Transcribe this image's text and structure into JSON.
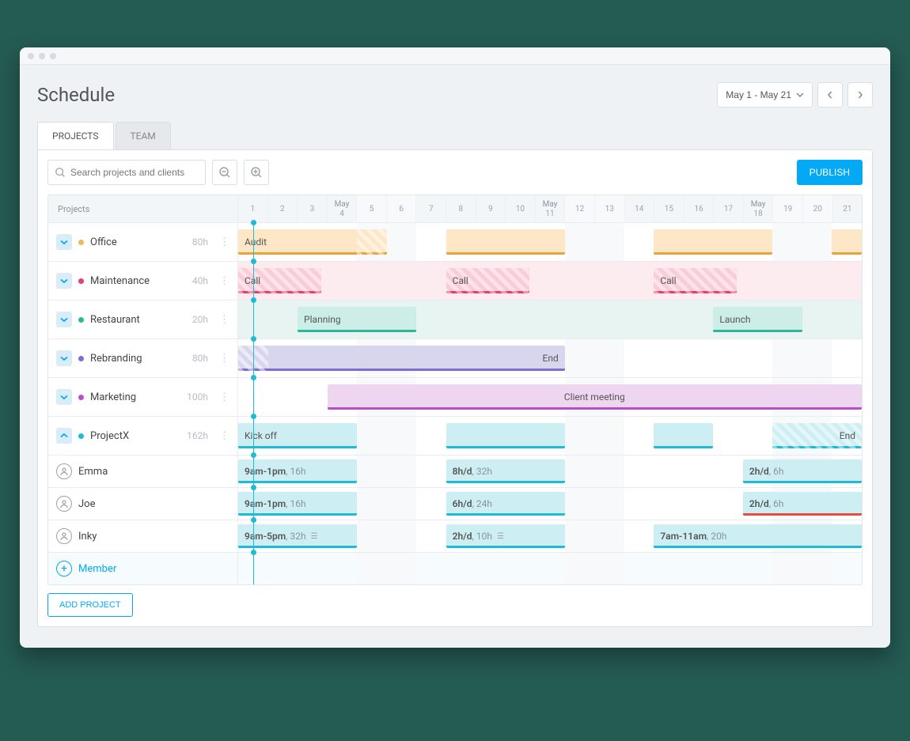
{
  "header": {
    "title": "Schedule",
    "date_range": "May 1 - May 21"
  },
  "tabs": {
    "projects": "PROJECTS",
    "team": "TEAM"
  },
  "toolbar": {
    "search_placeholder": "Search projects and clients",
    "publish": "PUBLISH"
  },
  "grid": {
    "left_header": "Projects",
    "month": "May",
    "days": [
      1,
      2,
      3,
      4,
      5,
      6,
      7,
      8,
      9,
      10,
      11,
      12,
      13,
      14,
      15,
      16,
      17,
      18,
      19,
      20,
      21
    ],
    "weekends": [
      [
        5,
        6
      ],
      [
        12,
        13
      ],
      [
        19,
        20
      ]
    ],
    "today": 1
  },
  "projects": [
    {
      "name": "Office",
      "hours": "80h",
      "color": "#f4b55b",
      "bars": [
        {
          "start": 1,
          "end": 5,
          "label": "Audit",
          "hatchEnd": true
        },
        {
          "start": 8,
          "end": 11
        },
        {
          "start": 15,
          "end": 18
        },
        {
          "start": 21,
          "end": 21
        }
      ],
      "fill": "#fde7c6",
      "line": "#e9a33a"
    },
    {
      "name": "Maintenance",
      "hours": "40h",
      "color": "#e83e6b",
      "bars": [
        {
          "start": 1,
          "end": 2.8,
          "label": "Call",
          "hatched": true
        },
        {
          "start": 8,
          "end": 9.8,
          "label": "Call",
          "hatched": true
        },
        {
          "start": 15,
          "end": 16.8,
          "label": "Call",
          "hatched": true
        }
      ],
      "fill": "#f9cdd8",
      "line": "#e83e6b",
      "bg": "#fcebef"
    },
    {
      "name": "Restaurant",
      "hours": "20h",
      "color": "#2fb59a",
      "bars": [
        {
          "start": 3,
          "end": 6,
          "label": "Planning"
        },
        {
          "start": 17,
          "end": 19,
          "label": "Launch"
        }
      ],
      "fill": "#cdeee6",
      "line": "#2fb59a",
      "bg": "#e7f4f1"
    },
    {
      "name": "Rebranding",
      "hours": "80h",
      "color": "#7b6fd1",
      "bars": [
        {
          "start": 1,
          "end": 11,
          "label": "End",
          "labelRight": true,
          "hatchStart": true
        }
      ],
      "fill": "#d8d5ef",
      "line": "#7b6fd1"
    },
    {
      "name": "Marketing",
      "hours": "100h",
      "color": "#b84fc5",
      "bars": [
        {
          "start": 4,
          "end": 21,
          "label": "Client meeting",
          "labelCenter": true
        }
      ],
      "fill": "#efd6f0",
      "line": "#b84fc5"
    },
    {
      "name": "ProjectX",
      "hours": "162h",
      "color": "#1fbad6",
      "expanded": true,
      "bars": [
        {
          "start": 1,
          "end": 4,
          "label": "Kick off"
        },
        {
          "start": 8,
          "end": 11
        },
        {
          "start": 15,
          "end": 16
        },
        {
          "start": 19,
          "end": 21,
          "label": "End",
          "labelRight": true,
          "hatched": true
        }
      ],
      "fill": "#cdeef3",
      "line": "#1fbad6",
      "members": [
        {
          "name": "Emma",
          "bars": [
            {
              "start": 1,
              "end": 4,
              "t1": "9am-1pm",
              "t2": ", 16h"
            },
            {
              "start": 8,
              "end": 11,
              "t1": "8h/d",
              "t2": ", 32h"
            },
            {
              "start": 18,
              "end": 21,
              "t1": "2h/d",
              "t2": ", 6h"
            }
          ]
        },
        {
          "name": "Joe",
          "bars": [
            {
              "start": 1,
              "end": 4,
              "t1": "9am-1pm",
              "t2": ", 16h"
            },
            {
              "start": 8,
              "end": 11,
              "t1": "6h/d",
              "t2": ", 24h"
            },
            {
              "start": 18,
              "end": 21,
              "t1": "2h/d",
              "t2": ", 6h",
              "over": true
            }
          ]
        },
        {
          "name": "Inky",
          "bars": [
            {
              "start": 1,
              "end": 4,
              "t1": "9am-5pm",
              "t2": ", 32h",
              "note": true
            },
            {
              "start": 8,
              "end": 11,
              "t1": "2h/d",
              "t2": ", 10h",
              "note": true
            },
            {
              "start": 15,
              "end": 21,
              "t1": "7am-11am",
              "t2": ", 20h"
            }
          ]
        }
      ]
    }
  ],
  "footer": {
    "add_member": "Member",
    "add_project": "ADD PROJECT"
  }
}
